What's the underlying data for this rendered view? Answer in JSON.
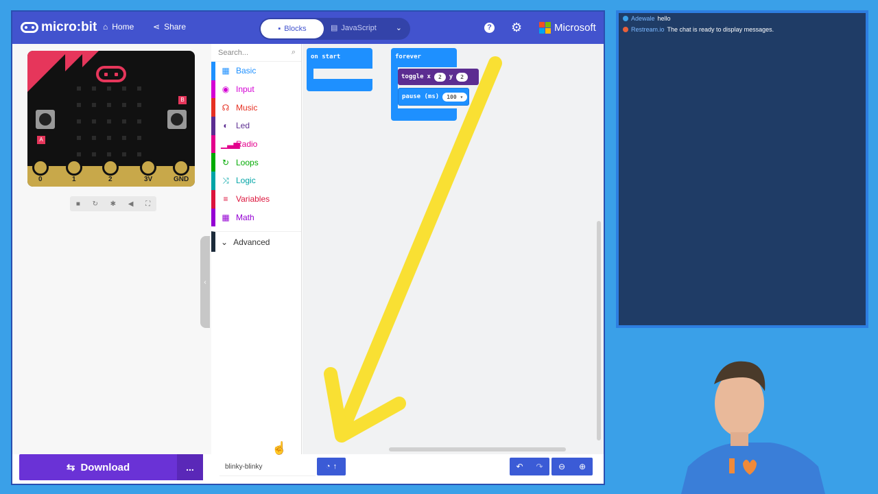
{
  "brand": {
    "name": "micro:bit",
    "ms": "Microsoft"
  },
  "nav": {
    "home": "Home",
    "share": "Share"
  },
  "editor_toggle": {
    "blocks": "Blocks",
    "javascript": "JavaScript"
  },
  "toolbox": {
    "search_placeholder": "Search...",
    "categories": [
      {
        "label": "Basic",
        "color": "#1e90ff",
        "icon": "grid-icon"
      },
      {
        "label": "Input",
        "color": "#d400d4",
        "icon": "target-icon"
      },
      {
        "label": "Music",
        "color": "#e63022",
        "icon": "headphones-icon"
      },
      {
        "label": "Led",
        "color": "#5c2d91",
        "icon": "toggle-icon"
      },
      {
        "label": "Radio",
        "color": "#e3008c",
        "icon": "signal-icon"
      },
      {
        "label": "Loops",
        "color": "#00aa00",
        "icon": "refresh-icon"
      },
      {
        "label": "Logic",
        "color": "#00a4a6",
        "icon": "shuffle-icon"
      },
      {
        "label": "Variables",
        "color": "#dc143c",
        "icon": "list-icon"
      },
      {
        "label": "Math",
        "color": "#9400d3",
        "icon": "calculator-icon"
      }
    ],
    "advanced": "Advanced"
  },
  "board": {
    "pins": [
      "0",
      "1",
      "2",
      "3V",
      "GND"
    ],
    "btn_a": "A",
    "btn_b": "B"
  },
  "blocks": {
    "on_start": "on start",
    "forever": "forever",
    "toggle": {
      "label": "toggle",
      "x_label": "x",
      "x": "2",
      "y_label": "y",
      "y": "2"
    },
    "pause": {
      "label": "pause (ms)",
      "value": "100"
    }
  },
  "bottom": {
    "download": "Download",
    "more": "...",
    "project_name": "blinky-blinky"
  },
  "chat": {
    "messages": [
      {
        "user": "Adewale",
        "text": "hello",
        "color": "#3aa0e8"
      },
      {
        "user": "Restream.io",
        "text": "The chat is ready to display messages.",
        "color": "#e8603a"
      }
    ]
  },
  "colors": {
    "accent": "#4253ce",
    "download": "#6a32d6",
    "arrow": "#f9e033"
  }
}
